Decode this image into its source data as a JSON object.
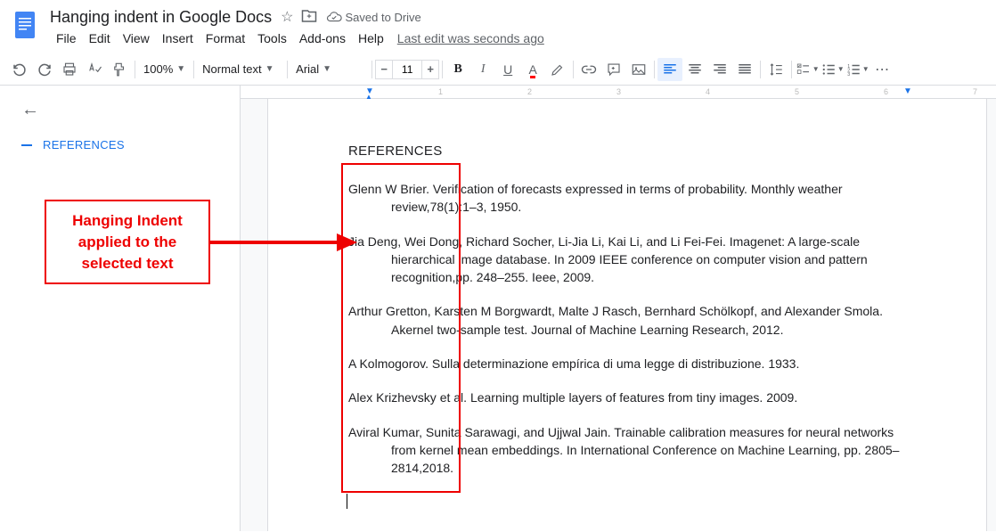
{
  "header": {
    "doc_title": "Hanging indent in Google Docs",
    "saved_status": "Saved to Drive",
    "last_edit": "Last edit was seconds ago"
  },
  "menu": {
    "file": "File",
    "edit": "Edit",
    "view": "View",
    "insert": "Insert",
    "format": "Format",
    "tools": "Tools",
    "addons": "Add-ons",
    "help": "Help"
  },
  "toolbar": {
    "zoom": "100%",
    "style": "Normal text",
    "font": "Arial",
    "fontsize": "11"
  },
  "outline": {
    "heading": "REFERENCES"
  },
  "callout": {
    "line1": "Hanging Indent",
    "line2": "applied to the",
    "line3": "selected text"
  },
  "document": {
    "heading": "REFERENCES",
    "refs": [
      {
        "plain": "Glenn W Brier. Verification of forecasts expressed in terms of probability. Monthly weather review,78(1):1–3, 1950."
      },
      {
        "plain": "Jia Deng, Wei Dong, Richard Socher, Li-Jia Li, Kai Li, and Li Fei-Fei. Imagenet: A large-scale hierarchical image database. In 2009 IEEE conference on computer vision and pattern recognition,pp. 248–255. Ieee, 2009."
      },
      {
        "plain": "Arthur Gretton, Karsten M Borgwardt, Malte J Rasch, Bernhard Schölkopf, and Alexander Smola. Akernel two-sample test. Journal of Machine Learning Research, 2012."
      },
      {
        "plain": "A Kolmogorov. Sulla determinazione empírica di uma legge di distribuzione. 1933."
      },
      {
        "plain": "Alex Krizhevsky et al. Learning multiple layers of features from tiny images. 2009."
      },
      {
        "plain": "Aviral Kumar, Sunita Sarawagi, and Ujjwal Jain. Trainable calibration measures for neural networks from kernel mean embeddings. In International Conference on Machine Learning, pp. 2805–2814,2018."
      }
    ]
  },
  "ruler": {
    "marks": [
      "1",
      "2",
      "3",
      "4",
      "5",
      "6",
      "7"
    ]
  }
}
